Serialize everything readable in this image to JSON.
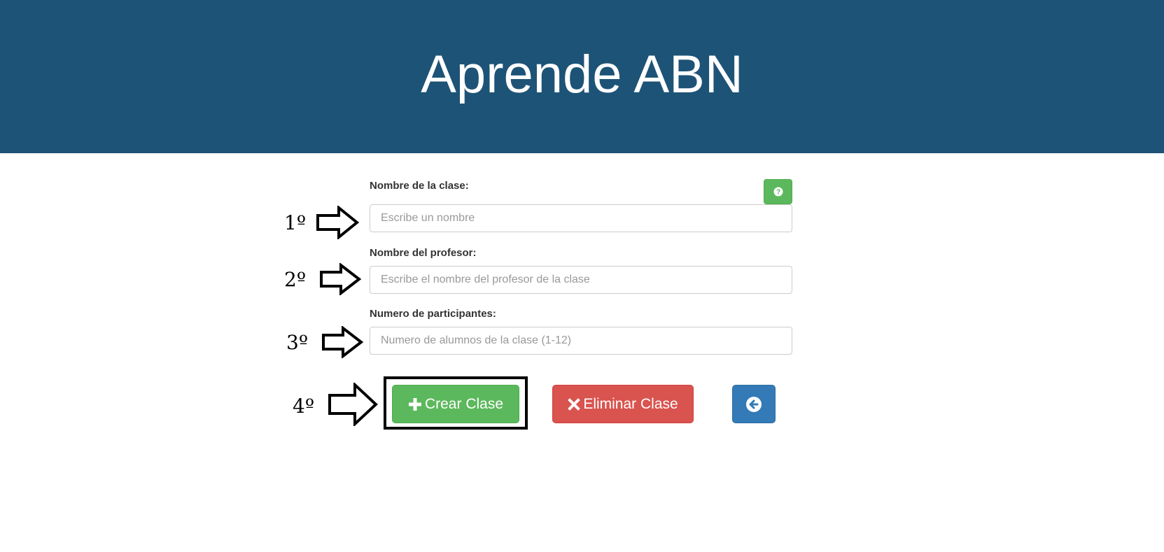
{
  "header": {
    "title": "Aprende ABN"
  },
  "form": {
    "class_name": {
      "label": "Nombre de la clase:",
      "placeholder": "Escribe un nombre",
      "value": ""
    },
    "teacher_name": {
      "label": "Nombre del profesor:",
      "placeholder": "Escribe el nombre del profesor de la clase",
      "value": ""
    },
    "participants": {
      "label": "Numero de participantes:",
      "placeholder": "Numero de alumnos de la clase (1-12)",
      "value": ""
    },
    "help_button_icon": "question-circle-icon"
  },
  "actions": {
    "create_label": "Crear Clase",
    "create_icon": "plus-icon",
    "delete_label": "Eliminar Clase",
    "delete_icon": "times-icon",
    "back_icon": "arrow-left-circle-icon"
  },
  "annotations": {
    "steps": [
      "1º",
      "2º",
      "3º",
      "4º"
    ]
  },
  "colors": {
    "header_bg": "#1d5376",
    "success": "#5cb85c",
    "danger": "#d9534f",
    "primary": "#337ab7"
  }
}
